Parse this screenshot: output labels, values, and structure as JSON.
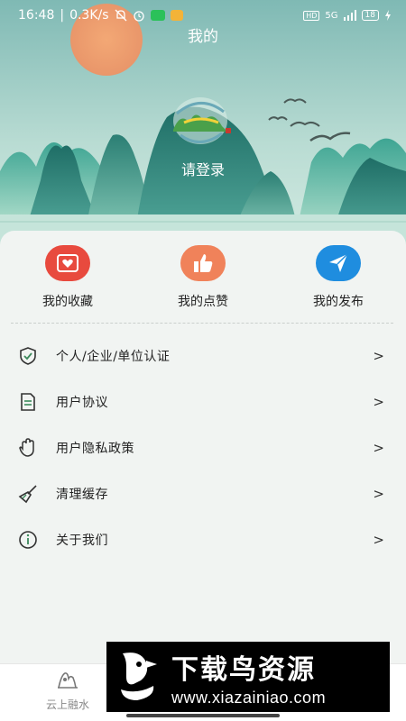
{
  "status_bar": {
    "time": "16:48",
    "net_speed": "0.3K/s",
    "signal": "5G",
    "hd": "HD",
    "battery": "18"
  },
  "header": {
    "title": "我的"
  },
  "profile": {
    "login_label": "请登录"
  },
  "quick_actions": [
    {
      "label": "我的收藏",
      "icon": "heart-icon",
      "color": "#e84a3e"
    },
    {
      "label": "我的点赞",
      "icon": "thumbs-up-icon",
      "color": "#f0825a"
    },
    {
      "label": "我的发布",
      "icon": "send-icon",
      "color": "#1f8ddf"
    }
  ],
  "menu": {
    "items": [
      {
        "label": "个人/企业/单位认证",
        "icon": "shield-check-icon"
      },
      {
        "label": "用户协议",
        "icon": "document-icon"
      },
      {
        "label": "用户隐私政策",
        "icon": "hand-icon"
      },
      {
        "label": "清理缓存",
        "icon": "broom-icon"
      },
      {
        "label": "关于我们",
        "icon": "info-icon"
      }
    ],
    "chevron": ">"
  },
  "bottom_nav": {
    "items": [
      {
        "label": "云上融水",
        "icon": "mountain-icon"
      }
    ]
  },
  "watermark": {
    "title": "下载鸟资源",
    "url": "www.xiazainiao.com"
  },
  "colors": {
    "accent_green": "#3c8a5c",
    "hero_teal": "#2f9a8a"
  }
}
